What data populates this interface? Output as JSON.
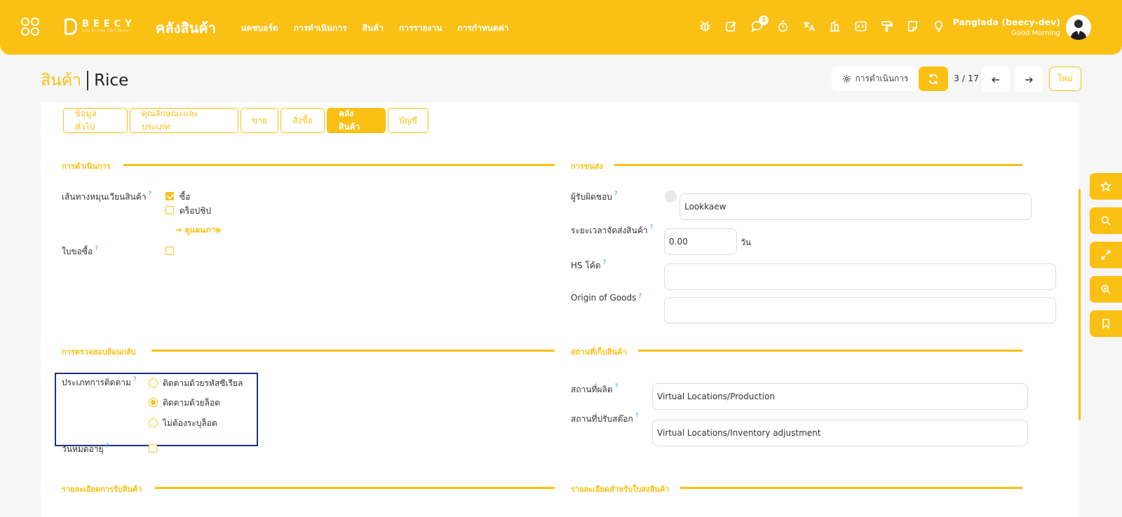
{
  "header": {
    "brand": "BEECY",
    "brand_tagline": "step by step start beecy",
    "app_title": "คลังสินค้า",
    "nav": [
      "แดชบอร์ด",
      "การดำเนินการ",
      "สินค้า",
      "การรายงาน",
      "การกำหนดค่า"
    ],
    "icons": [
      "bug-icon",
      "edit-icon",
      "chat-icon",
      "timer-icon",
      "translate-icon",
      "building-icon",
      "code-icon",
      "paint-roller-icon",
      "note-icon",
      "lightbulb-icon"
    ],
    "chat_badge": "3",
    "user_name": "Panglada (beecy-dev)",
    "greeting": "Good Morning"
  },
  "breadcrumb": {
    "parent": "สินค้า",
    "current": "Rice"
  },
  "toolbar": {
    "action_label": "การดำเนินการ",
    "pager": "3 / 17",
    "new_label": "ใหม่"
  },
  "tabs": [
    {
      "label": "ข้อมูลทั่วไป",
      "active": false
    },
    {
      "label": "คุณลักษณะและประเภท",
      "active": false
    },
    {
      "label": "ขาย",
      "active": false
    },
    {
      "label": "สั่งซื้อ",
      "active": false
    },
    {
      "label": "คลังสินค้า",
      "active": true
    },
    {
      "label": "บัญชี",
      "active": false
    }
  ],
  "operations": {
    "title": "การดำเนินการ",
    "routes_label": "เส้นทางหมุนเวียนสินค้า",
    "route_buy": "ซื้อ",
    "route_dropship": "ดร็อปชิป",
    "diagram_link": "ดูแผนภาพ",
    "requisition_label": "ใบขอซื้อ"
  },
  "traceability": {
    "title": "การตรวจสอบย้อนกลับ",
    "tracking_label": "ประเภทการติดตาม",
    "options": [
      "ติดตามด้วยรหัสซีเรียล",
      "ติดตามด้วยล็อต",
      "ไม่ต้องระบุล็อต"
    ],
    "selected": 1,
    "expiry_label": "วันหมดอายุ"
  },
  "receipts": {
    "title": "รายละเอียดการรับสินค้า"
  },
  "logistics": {
    "title": "การขนส่ง",
    "responsible_label": "ผู้รับผิดชอบ",
    "responsible_value": "Lookkaew",
    "lead_time_label": "ระยะเวลาจัดส่งสินค้า",
    "lead_time_value": "0.00",
    "lead_time_unit": "วัน",
    "hs_label": "HS โค้ด",
    "hs_value": "",
    "origin_label": "Origin of Goods",
    "origin_value": ""
  },
  "locations": {
    "title": "สถานที่เก็บสินค้า",
    "production_label": "สถานที่ผลิต",
    "production_value": "Virtual Locations/Production",
    "inventory_label": "สถานที่ปรับสต๊อก",
    "inventory_value": "Virtual Locations/Inventory adjustment"
  },
  "delivery": {
    "title": "รายละเอียดสำหรับใบส่งสินค้า"
  },
  "side_tools": [
    "star-icon",
    "search-icon",
    "expand-icon",
    "zoom-icon",
    "bookmark-icon"
  ]
}
